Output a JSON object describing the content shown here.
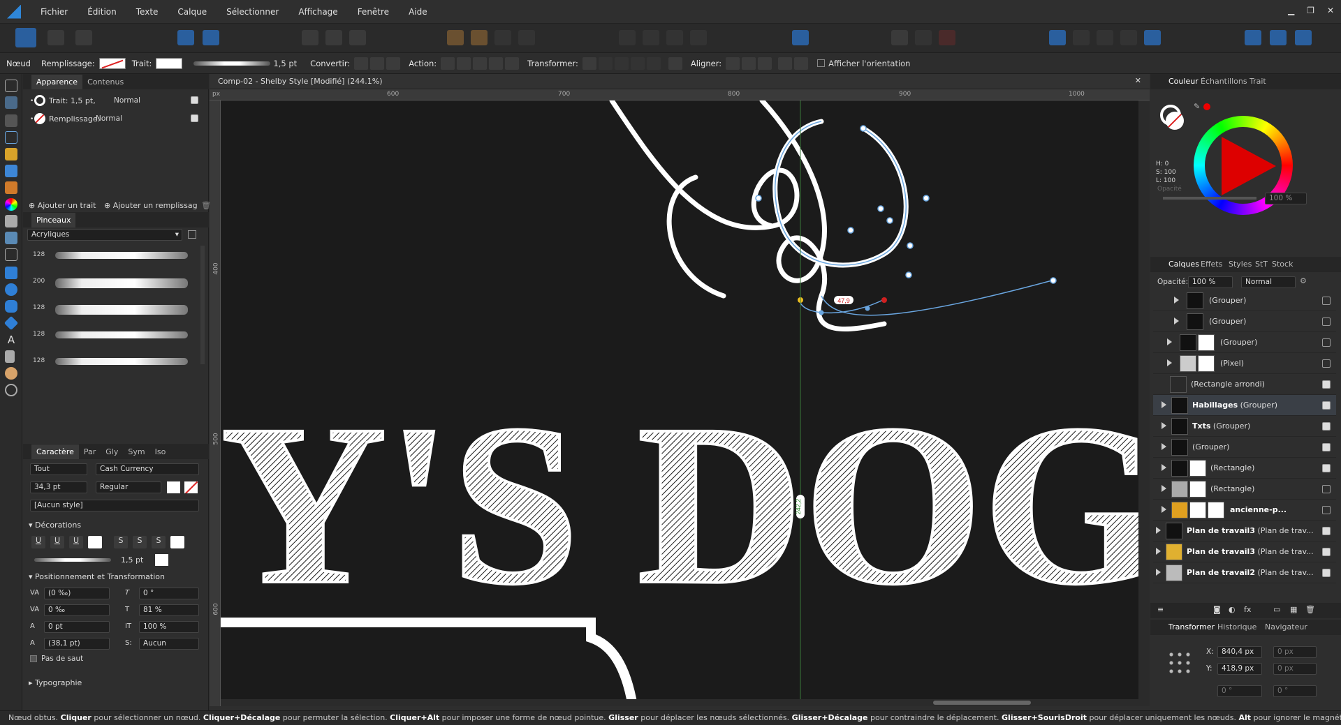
{
  "menu": {
    "items": [
      "Fichier",
      "Édition",
      "Texte",
      "Calque",
      "Sélectionner",
      "Affichage",
      "Fenêtre",
      "Aide"
    ]
  },
  "context_bar": {
    "tool_name": "Nœud",
    "fill_label": "Remplissage:",
    "stroke_label": "Trait:",
    "stroke_width": "1,5 pt",
    "convert_label": "Convertir:",
    "action_label": "Action:",
    "transform_label": "Transformer:",
    "align_label": "Aligner:",
    "show_orientation": "Afficher l'orientation"
  },
  "left": {
    "appearance_tabs": [
      "Apparence",
      "Contenus"
    ],
    "stroke_row": {
      "label": "Trait: 1,5 pt,",
      "blend": "Normal"
    },
    "fill_row": {
      "label": "Remplissage:",
      "blend": "Normal"
    },
    "add_stroke": "Ajouter un trait",
    "add_fill": "Ajouter un remplissag",
    "brushes_tab": "Pinceaux",
    "brush_category": "Acryliques",
    "brush_sizes": [
      "128",
      "200",
      "128",
      "128",
      "128"
    ],
    "char_tabs": [
      "Caractère",
      "Par",
      "Gly",
      "Sym",
      "Iso"
    ],
    "char": {
      "scope": "Tout",
      "font": "Cash Currency",
      "size": "34,3 pt",
      "weight": "Regular",
      "style": "[Aucun style]"
    },
    "decorations_header": "Décorations",
    "decoration_stroke": "1,5 pt",
    "positioning_header": "Positionnement et Transformation",
    "positioning": {
      "tracking": "(0 ‰)",
      "kerning": "0 ‰",
      "baseline": "0 pt",
      "leading": "(38,1 pt)",
      "skew": "0 °",
      "vscale": "81 %",
      "hscale": "100 %",
      "case": "Aucun"
    },
    "no_break": "Pas de saut",
    "typography_header": "Typographie"
  },
  "document": {
    "title": "Comp-02 - Shelby Style [Modifié] (244.1%)",
    "ruler_top": [
      "600",
      "700",
      "800",
      "900",
      "1000"
    ],
    "ruler_left": [
      "400",
      "500",
      "600"
    ],
    "ruler_unit": "px",
    "canvas_text": "Y'S DOG",
    "node_label": "47,9",
    "guide_label": "242,2"
  },
  "right": {
    "color_tabs": [
      "Couleur",
      "Échantillons",
      "Trait"
    ],
    "hsl": {
      "h": "H: 0",
      "s": "S: 100",
      "l": "L: 100"
    },
    "opacity_label": "Opacité",
    "opacity_value": "100 %",
    "layer_tabs": [
      "Calques",
      "Effets",
      "Styles",
      "StT",
      "Stock"
    ],
    "layer_opacity_label": "Opacité:",
    "layer_opacity": "100 %",
    "layer_blend": "Normal",
    "layers": [
      {
        "name": "(Grouper)",
        "bold": ""
      },
      {
        "name": "(Grouper)",
        "bold": ""
      },
      {
        "name": "(Grouper)",
        "bold": ""
      },
      {
        "name": "(Pixel)",
        "bold": ""
      },
      {
        "name": "(Rectangle arrondi)",
        "bold": ""
      },
      {
        "name": " (Grouper)",
        "bold": "Habillages"
      },
      {
        "name": " (Grouper)",
        "bold": "Txts"
      },
      {
        "name": "(Grouper)",
        "bold": ""
      },
      {
        "name": "(Rectangle)",
        "bold": ""
      },
      {
        "name": "(Rectangle)",
        "bold": ""
      },
      {
        "name": "",
        "bold": "ancienne-p..."
      },
      {
        "name": " (Plan de trav...",
        "bold": "Plan de travail3"
      },
      {
        "name": " (Plan de trav...",
        "bold": "Plan de travail3"
      },
      {
        "name": " (Plan de trav...",
        "bold": "Plan de travail2"
      }
    ],
    "transform_tabs": [
      "Transformer",
      "Historique",
      "Navigateur"
    ],
    "transform": {
      "x_label": "X:",
      "x": "840,4 px",
      "y_label": "Y:",
      "y": "418,9 px",
      "w": "0 px",
      "h": "0 px",
      "rot": "0 °",
      "shear": "0 °"
    }
  },
  "status": {
    "segments": [
      {
        "t": "Nœud obtus. ",
        "b": false
      },
      {
        "t": "Cliquer",
        "b": true
      },
      {
        "t": " pour sélectionner un nœud. ",
        "b": false
      },
      {
        "t": "Cliquer+Décalage",
        "b": true
      },
      {
        "t": " pour permuter la sélection. ",
        "b": false
      },
      {
        "t": "Cliquer+Alt",
        "b": true
      },
      {
        "t": " pour imposer une forme de nœud pointue. ",
        "b": false
      },
      {
        "t": "Glisser",
        "b": true
      },
      {
        "t": " pour déplacer les nœuds sélectionnés. ",
        "b": false
      },
      {
        "t": "Glisser+Décalage",
        "b": true
      },
      {
        "t": " pour contraindre le déplacement. ",
        "b": false
      },
      {
        "t": "Glisser+SourisDroit",
        "b": true
      },
      {
        "t": " pour déplacer uniquement les nœuds. ",
        "b": false
      },
      {
        "t": "Alt",
        "b": true
      },
      {
        "t": " pour ignorer le magnétisme.",
        "b": false
      }
    ]
  },
  "colors": {
    "accent": "#2f86d8",
    "canvas": "#1b1b1b",
    "selection": "#6aa6e0"
  }
}
